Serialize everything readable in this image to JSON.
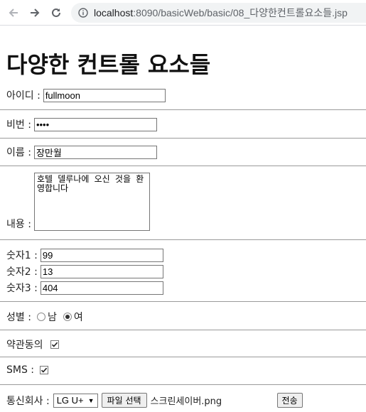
{
  "browser": {
    "url_host": "localhost",
    "url_path": ":8090/basicWeb/basic/08_다양한컨트롤요소들.jsp"
  },
  "page": {
    "title": "다양한 컨트롤 요소들"
  },
  "form": {
    "id_label": "아이디 :",
    "id_value": "fullmoon",
    "pw_label": "비번 :",
    "pw_value": "••••",
    "name_label": "이름 :",
    "name_value": "장만월",
    "content_label": "내용 :",
    "content_value": "호텔 델루나에 오신 것을 환영합니다",
    "num1_label": "숫자1 :",
    "num1_value": "99",
    "num2_label": "숫자2 :",
    "num2_value": "13",
    "num3_label": "숫자3 :",
    "num3_value": "404",
    "gender_label": "성별 :",
    "gender_male": "남",
    "gender_female": "여",
    "gender_selected": "여",
    "agree_label": "약관동의",
    "agree_checked": true,
    "sms_label": "SMS :",
    "sms_checked": true,
    "carrier_label": "통신회사 :",
    "carrier_selected": "LG U+",
    "file_button": "파일 선택",
    "file_name": "스크린세이버.png",
    "submit_label": "전송"
  }
}
